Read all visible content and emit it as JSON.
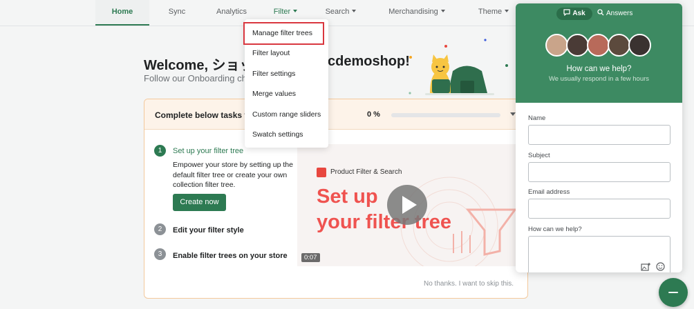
{
  "nav": {
    "items": [
      {
        "label": "Home",
        "has_caret": false
      },
      {
        "label": "Sync",
        "has_caret": false
      },
      {
        "label": "Analytics",
        "has_caret": false
      },
      {
        "label": "Filter",
        "has_caret": true
      },
      {
        "label": "Search",
        "has_caret": true
      },
      {
        "label": "Merchandising",
        "has_caret": true
      },
      {
        "label": "Theme",
        "has_caret": true
      }
    ],
    "active": "Home",
    "open_menu": "Filter"
  },
  "filter_menu": {
    "items": [
      {
        "label": "Manage filter trees",
        "highlighted": true
      },
      {
        "label": "Filter layout"
      },
      {
        "label": "Filter settings"
      },
      {
        "label": "Merge values"
      },
      {
        "label": "Custom range sliders"
      },
      {
        "label": "Swatch settings"
      }
    ]
  },
  "welcome": {
    "title_start": "Welcome, ショッ",
    "title_end": "cdemoshop!",
    "subtitle": "Follow our Onboarding ch"
  },
  "tasks": {
    "header": "Complete below tasks to",
    "progress_label": "0 %",
    "progress_value": 0,
    "steps": [
      {
        "number": "1",
        "title": "Set up your filter tree",
        "description": "Empower your store by setting up the default filter tree or create your own collection filter tree.",
        "button": "Create now",
        "active": true
      },
      {
        "number": "2",
        "title": "Edit your filter style",
        "active": false
      },
      {
        "number": "3",
        "title": "Enable filter trees on your store",
        "active": false
      }
    ],
    "video": {
      "brand": "Product Filter & Search",
      "headline_line1": "Set up",
      "headline_line2": "your filter tree",
      "duration": "0:07"
    },
    "skip_link": "No thanks. I want to skip this."
  },
  "help_widget": {
    "tabs": [
      {
        "label": "Ask",
        "icon": "chat-bubble-icon",
        "active": true
      },
      {
        "label": "Answers",
        "icon": "search-icon",
        "active": false
      }
    ],
    "heading": "How can we help?",
    "subheading": "We usually respond in a few hours",
    "fields": [
      {
        "label": "Name",
        "value": ""
      },
      {
        "label": "Subject",
        "value": ""
      },
      {
        "label": "Email address",
        "value": ""
      },
      {
        "label": "How can we help?",
        "value": ""
      }
    ],
    "avatar_count": 5
  },
  "fab_icon": "minimize-icon",
  "colors": {
    "brand_green": "#2d7a52",
    "widget_green": "#3d8a62",
    "highlight_red": "#d9363e",
    "video_red": "#ef5350"
  }
}
